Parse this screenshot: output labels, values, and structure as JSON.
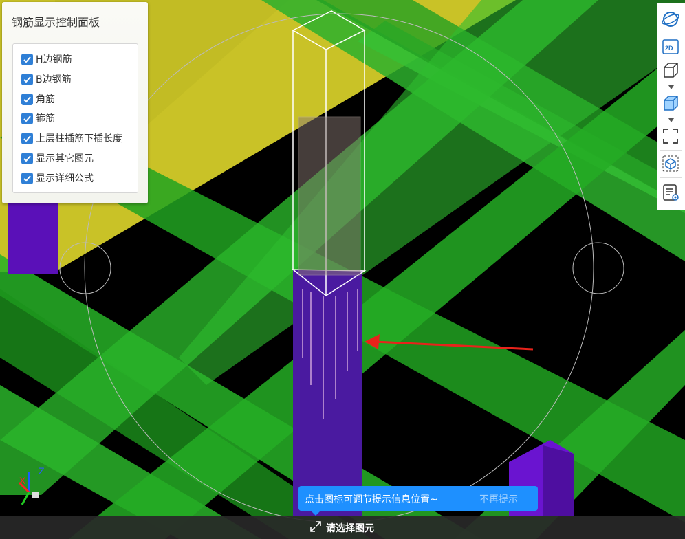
{
  "panel": {
    "title": "钢筋显示控制面板",
    "options": [
      {
        "label": "H边钢筋",
        "checked": true
      },
      {
        "label": "B边钢筋",
        "checked": true
      },
      {
        "label": "角筋",
        "checked": true
      },
      {
        "label": "箍筋",
        "checked": true
      },
      {
        "label": "上层柱插筋下插长度",
        "checked": true
      },
      {
        "label": "显示其它图元",
        "checked": true
      },
      {
        "label": "显示详细公式",
        "checked": true
      }
    ]
  },
  "toolbar": {
    "icons": [
      "orbit-icon",
      "view-2d-icon",
      "wireframe-cube-icon",
      "solid-cube-icon",
      "fit-view-icon",
      "section-box-icon",
      "properties-icon"
    ],
    "labels": {
      "view_2d": "2D"
    }
  },
  "tooltip": {
    "text": "点击图标可调节提示信息位置~",
    "dismiss": "不再提示"
  },
  "status": {
    "text": "请选择图元"
  },
  "axes": {
    "x": "X",
    "z": "Z"
  },
  "colors": {
    "beam_green": "#2db02d",
    "slab_yellow": "#c9c227",
    "column_purple": "#5a10b8",
    "accent_blue": "#1e90ff",
    "arrow_red": "#e8231b"
  }
}
